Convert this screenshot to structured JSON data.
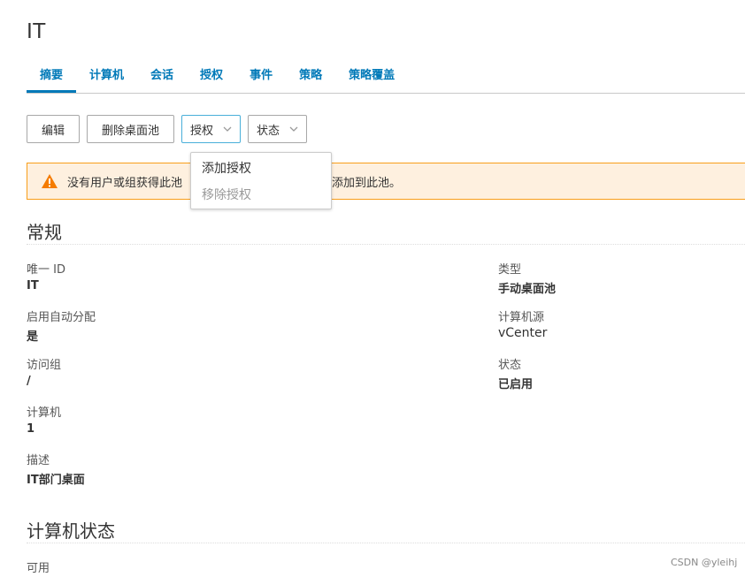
{
  "page": {
    "title": "IT"
  },
  "tabs": [
    {
      "label": "摘要",
      "active": true
    },
    {
      "label": "计算机",
      "active": false
    },
    {
      "label": "会话",
      "active": false
    },
    {
      "label": "授权",
      "active": false
    },
    {
      "label": "事件",
      "active": false
    },
    {
      "label": "策略",
      "active": false
    },
    {
      "label": "策略覆盖",
      "active": false
    }
  ],
  "toolbar": {
    "edit_label": "编辑",
    "delete_label": "删除桌面池",
    "entitlements_label": "授权",
    "status_label": "状态"
  },
  "dropdown": {
    "items": [
      {
        "label": "添加授权",
        "enabled": true
      },
      {
        "label": "移除授权",
        "enabled": false
      }
    ]
  },
  "alert": {
    "icon": "warning-icon",
    "text_before": "没有用户或组获得此池",
    "text_after": "户添加到此池。",
    "color": "#f89e1a"
  },
  "general": {
    "title": "常规",
    "left": [
      {
        "label": "唯一 ID",
        "value": "IT"
      },
      {
        "label": "启用自动分配",
        "value": "是"
      },
      {
        "label": "访问组",
        "value": "/"
      },
      {
        "label": "计算机",
        "value": "1"
      },
      {
        "label": "描述",
        "value": "IT部门桌面"
      }
    ],
    "right": [
      {
        "label": "类型",
        "value": "手动桌面池"
      },
      {
        "label": "计算机源",
        "value": "vCenter"
      },
      {
        "label": "状态",
        "value": "已启用"
      }
    ]
  },
  "machine_status": {
    "title": "计算机状态",
    "first_label": "可用"
  },
  "watermark": "CSDN @yleihj",
  "colors": {
    "accent": "#0079b8",
    "alert_bg": "#fef0df",
    "alert_border": "#f89e1a"
  }
}
